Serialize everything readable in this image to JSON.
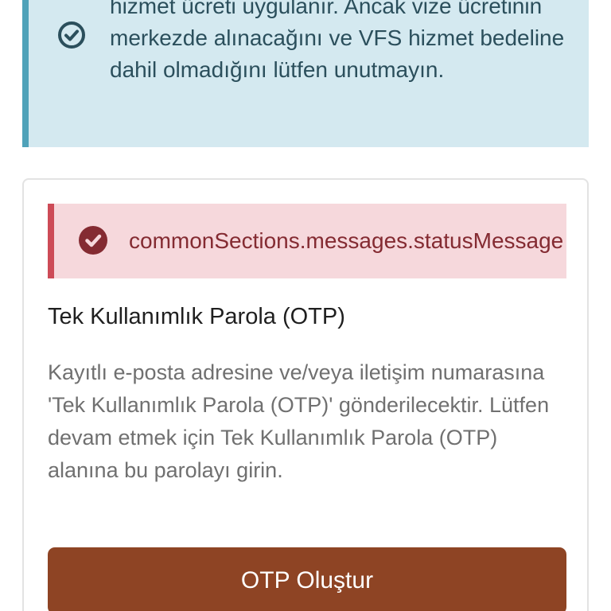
{
  "info_alert": {
    "text": "hizmet ücreti uygulanır. Ancak vize ücretinin merkezde alınacağını ve VFS hizmet bedeline dahil olmadığını lütfen unutmayın.",
    "icon": "check-circle-icon",
    "colors": {
      "background": "#d4e9f0",
      "border": "#4fa2b9",
      "text": "#2b4f5c"
    }
  },
  "status_alert": {
    "text": "commonSections.messages.statusMessage",
    "icon": "check-circle-icon",
    "colors": {
      "background": "#f6d8dc",
      "border": "#cd4b57",
      "text": "#842b32"
    }
  },
  "otp_card": {
    "title": "Tek Kullanımlık Parola (OTP)",
    "description": "Kayıtlı e-posta adresine ve/veya iletişim numarasına 'Tek Kullanımlık Parola (OTP)' gönderilecektir. Lütfen devam etmek için Tek Kullanımlık Parola (OTP) alanına bu parolayı girin.",
    "button_label": "OTP Oluştur",
    "colors": {
      "button": "#8e4424"
    }
  }
}
